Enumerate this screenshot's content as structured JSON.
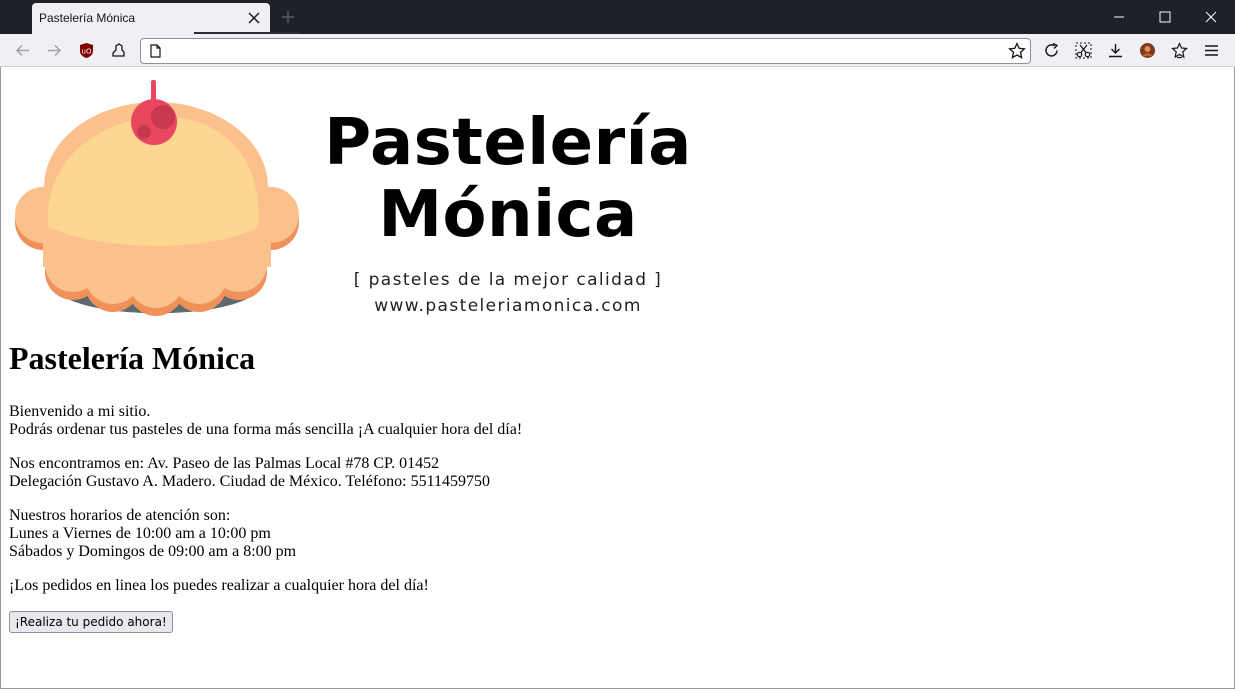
{
  "browser": {
    "tab_title": "Pastelería Mónica",
    "url": ""
  },
  "logo": {
    "title_line1": "Pastelería",
    "title_line2": "Mónica",
    "tagline": "[ pasteles de la mejor calidad ]",
    "website": "www.pasteleriamonica.com",
    "colors": {
      "cream": "#fdd792",
      "crust": "#fbc18d",
      "crust_dark": "#f0915a",
      "base": "#5f6a6e",
      "cherry": "#e8475f"
    }
  },
  "page": {
    "heading": "Pastelería Mónica",
    "welcome": "Bienvenido a mi sitio.",
    "order_info": "Podrás ordenar tus pasteles de una forma más sencilla ¡A cualquier hora del día!",
    "address_line1": "Nos encontramos en: Av. Paseo de las Palmas Local #78 CP. 01452",
    "address_line2": "Delegación Gustavo A. Madero. Ciudad de México. Teléfono: 5511459750",
    "hours_title": "Nuestros horarios de atención son:",
    "hours_weekdays": "Lunes a Viernes de 10:00 am a 10:00 pm",
    "hours_weekend": "Sábados y Domingos de 09:00 am a 8:00 pm",
    "online_orders": "¡Los pedidos en linea los puedes realizar a cualquier hora del día!",
    "order_button": "¡Realiza tu pedido ahora!"
  }
}
